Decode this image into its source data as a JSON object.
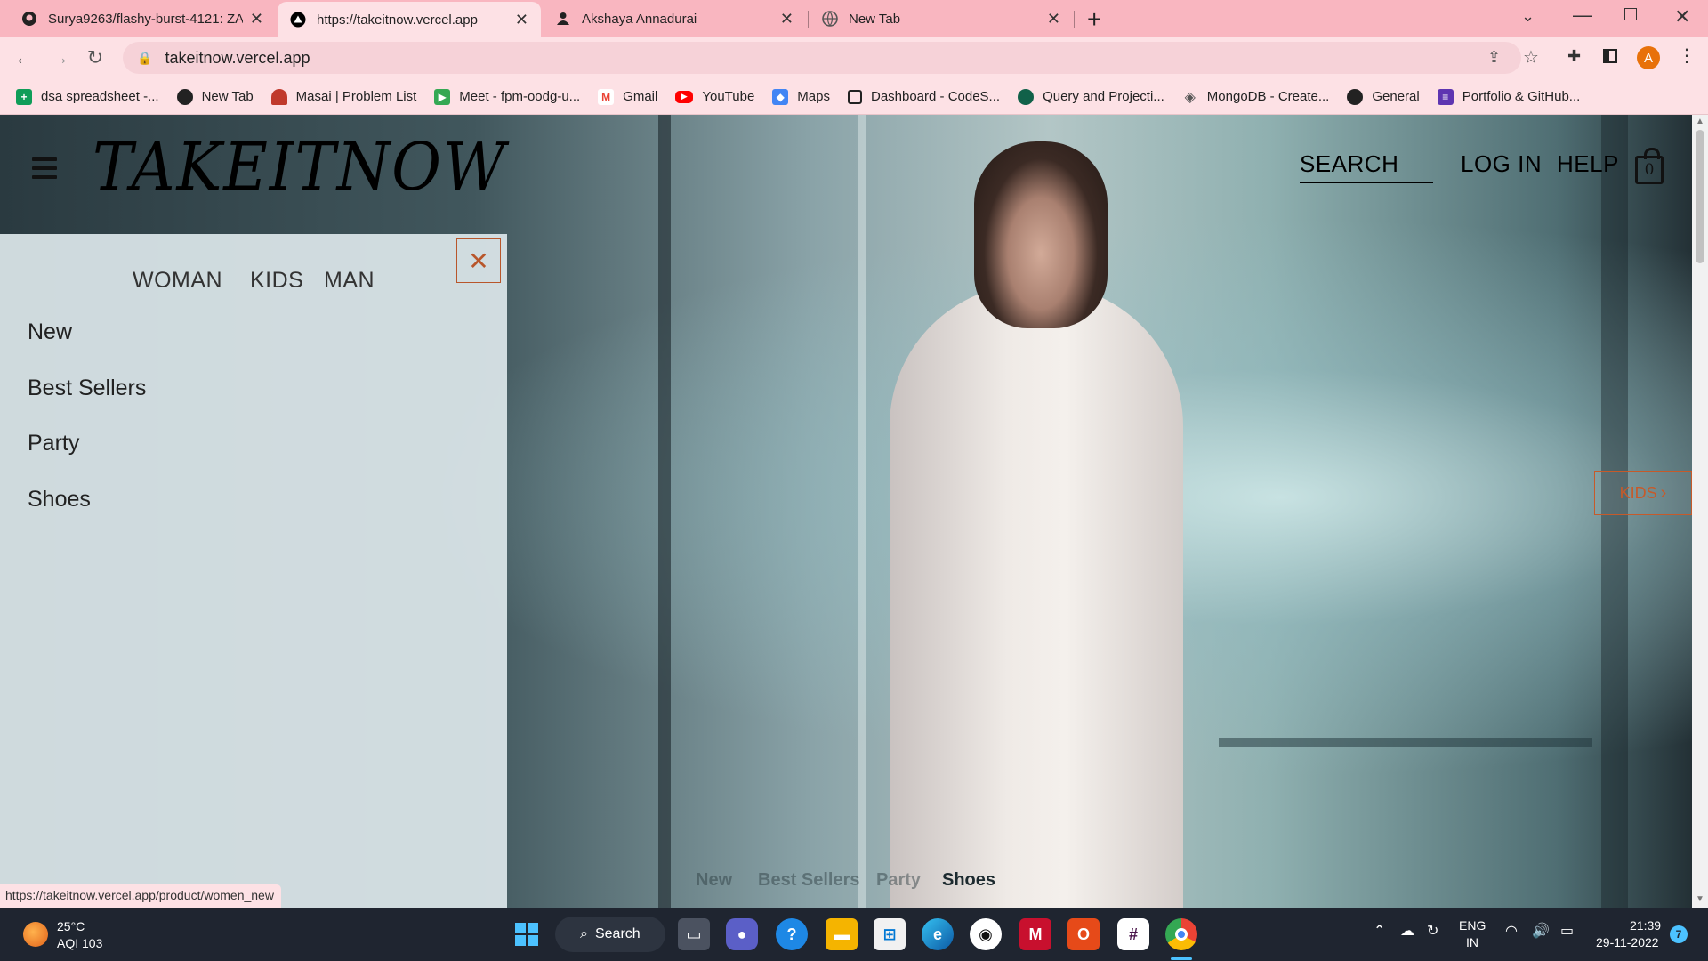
{
  "browser": {
    "tabs": [
      {
        "title": "Surya9263/flashy-burst-4121: ZA",
        "icon": "github-icon"
      },
      {
        "title": "https://takeitnow.vercel.app",
        "icon": "vercel-icon"
      },
      {
        "title": "Akshaya Annadurai",
        "icon": "person-icon"
      },
      {
        "title": "New Tab",
        "icon": "globe-icon"
      }
    ],
    "url": "takeitnow.vercel.app",
    "profile_initial": "A",
    "bookmarks": [
      {
        "label": "dsa spreadsheet -...",
        "icon": "sheets-icon",
        "color": "#0f9d58"
      },
      {
        "label": "New Tab",
        "icon": "globe-icon",
        "color": "#222222"
      },
      {
        "label": "Masai | Problem List",
        "icon": "masai-icon",
        "color": "#c0392b"
      },
      {
        "label": "Meet - fpm-oodg-u...",
        "icon": "meet-icon",
        "color": "#34a853"
      },
      {
        "label": "Gmail",
        "icon": "gmail-icon",
        "color": "#ea4335"
      },
      {
        "label": "YouTube",
        "icon": "youtube-icon",
        "color": "#ff0000"
      },
      {
        "label": "Maps",
        "icon": "maps-icon",
        "color": "#4285f4"
      },
      {
        "label": "Dashboard - CodeS...",
        "icon": "square-icon",
        "color": "#222222"
      },
      {
        "label": "Query and Projecti...",
        "icon": "mongodb-leaf-icon",
        "color": "#116149"
      },
      {
        "label": "MongoDB - Create...",
        "icon": "diamond-icon",
        "color": "#555555"
      },
      {
        "label": "General",
        "icon": "github-icon",
        "color": "#222222"
      },
      {
        "label": "Portfolio & GitHub...",
        "icon": "forms-icon",
        "color": "#5e35b1"
      }
    ],
    "status_url": "https://takeitnow.vercel.app/product/women_new"
  },
  "site": {
    "logo": "TAKEITNOW",
    "nav": {
      "search": "SEARCH",
      "login": "LOG IN",
      "help": "HELP"
    },
    "bag_count": "0",
    "categories": [
      "WOMAN",
      "KIDS",
      "MAN"
    ],
    "menu_items": [
      "New",
      "Best Sellers",
      "Party",
      "Shoes"
    ],
    "kids_button": "KIDS",
    "bottom_links": [
      "New",
      "Best Sellers",
      "Party",
      "Shoes"
    ],
    "accent_color": "#c65a2a"
  },
  "taskbar": {
    "weather_temp": "25°C",
    "weather_aqi": "AQI 103",
    "search_label": "Search",
    "lang_top": "ENG",
    "lang_bottom": "IN",
    "time": "21:39",
    "date": "29-11-2022",
    "notification_count": "7"
  }
}
